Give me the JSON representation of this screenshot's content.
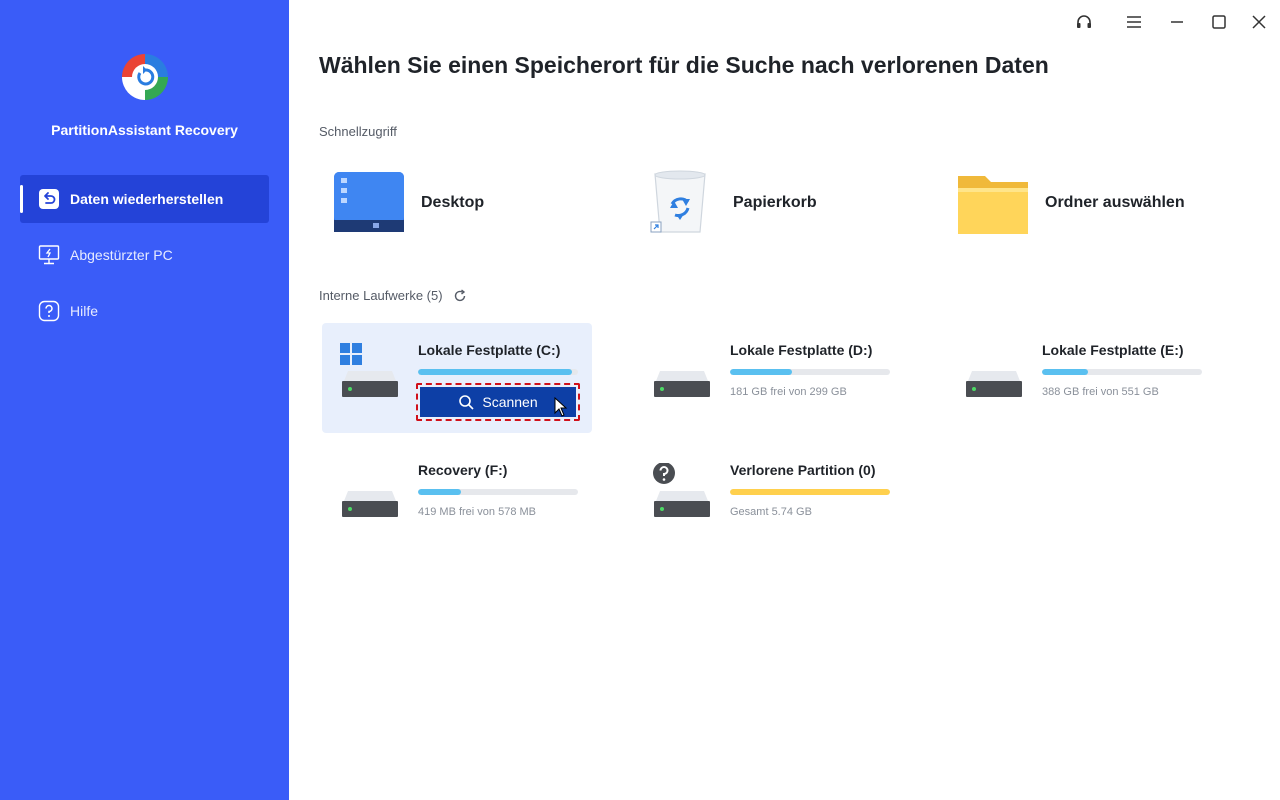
{
  "app": {
    "name": "PartitionAssistant Recovery"
  },
  "sidebar": {
    "items": [
      {
        "label": "Daten wiederherstellen",
        "icon": "restore-icon",
        "active": true
      },
      {
        "label": "Abgestürzter PC",
        "icon": "monitor-icon",
        "active": false
      },
      {
        "label": "Hilfe",
        "icon": "help-icon",
        "active": false
      }
    ]
  },
  "window": {
    "icons": [
      "headset-icon",
      "menu-icon",
      "minimize-icon",
      "maximize-icon",
      "close-icon"
    ]
  },
  "main": {
    "title": "Wählen Sie einen Speicherort für die Suche nach verlorenen Daten",
    "quick_access": {
      "label": "Schnellzugriff",
      "items": [
        {
          "label": "Desktop",
          "icon": "desktop-icon"
        },
        {
          "label": "Papierkorb",
          "icon": "recycle-bin-icon"
        },
        {
          "label": "Ordner auswählen",
          "icon": "folder-icon"
        }
      ]
    },
    "drives": {
      "label": "Interne Laufwerke (5)",
      "items": [
        {
          "name": "Lokale Festplatte (C:)",
          "subtitle": "",
          "usage": 0.96,
          "bar_color": "#5ac0f0",
          "selected": true,
          "scan_label": "Scannen"
        },
        {
          "name": "Lokale Festplatte (D:)",
          "subtitle": "181 GB frei von 299 GB",
          "usage": 0.39,
          "bar_color": "#5ac0f0"
        },
        {
          "name": "Lokale Festplatte (E:)",
          "subtitle": "388 GB frei von 551 GB",
          "usage": 0.29,
          "bar_color": "#5ac0f0"
        },
        {
          "name": "Recovery (F:)",
          "subtitle": "419 MB frei von 578 MB",
          "usage": 0.27,
          "bar_color": "#5ac0f0"
        },
        {
          "name": "Verlorene Partition (0)",
          "subtitle": "Gesamt 5.74 GB",
          "usage": 1.0,
          "bar_color": "#ffd04d"
        }
      ]
    }
  },
  "colors": {
    "sidebar": "#3a5cf8",
    "sidebar_active": "#2443d8",
    "scan_button": "#0d3fa6",
    "selected_card": "#e8effc"
  }
}
